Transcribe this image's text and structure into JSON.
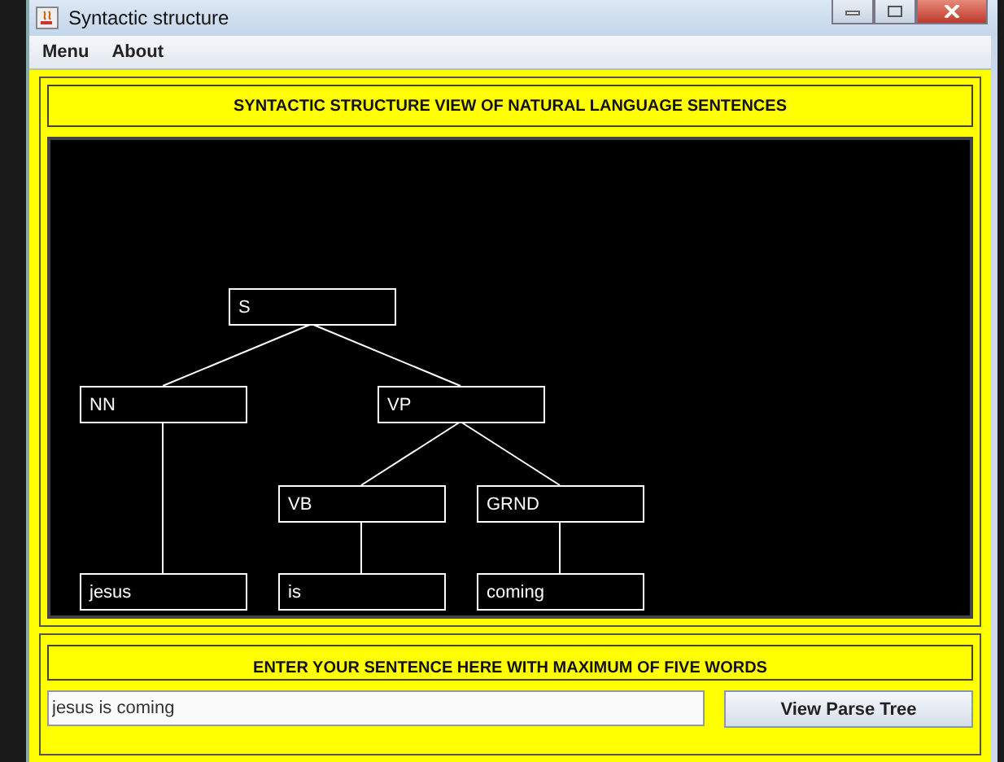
{
  "window": {
    "title": "Syntactic structure"
  },
  "menu": [
    "Menu",
    "About"
  ],
  "header": "SYNTACTIC STRUCTURE VIEW OF NATURAL LANGUAGE SENTENCES",
  "tree": {
    "label": "S",
    "children": [
      {
        "label": "NN",
        "children": [
          {
            "label": "jesus"
          }
        ]
      },
      {
        "label": "VP",
        "children": [
          {
            "label": "VB",
            "children": [
              {
                "label": "is"
              }
            ]
          },
          {
            "label": "GRND",
            "children": [
              {
                "label": "coming"
              }
            ]
          }
        ]
      }
    ]
  },
  "prompt": "ENTER YOUR SENTENCE HERE WITH MAXIMUM OF FIVE WORDS",
  "sentence_field": {
    "value": "jesus is coming"
  },
  "button": "View Parse Tree"
}
